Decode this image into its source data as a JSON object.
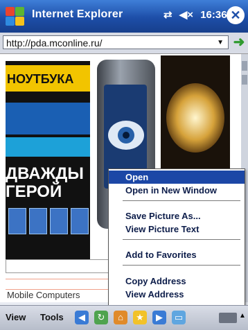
{
  "titlebar": {
    "app_title": "Internet Explorer",
    "connectivity_glyph": "⇄",
    "volume_glyph": "◀×",
    "time": "16:36",
    "close_glyph": "✕"
  },
  "address": {
    "url": "http://pda.mconline.ru/",
    "dropdown_glyph": "▼",
    "go_glyph": "➜"
  },
  "page": {
    "magazine_headline_1": "НОУТБУКА",
    "magazine_headline_2": "ДВАЖДЫ ГЕРОЙ",
    "footer_text": "Mobile Computers"
  },
  "context_menu": {
    "items": [
      {
        "label": "Open"
      },
      {
        "label": "Open in New Window"
      },
      {
        "label": "Save Picture As..."
      },
      {
        "label": "View Picture Text"
      },
      {
        "label": "Add to Favorites"
      },
      {
        "label": "Copy Address"
      },
      {
        "label": "View Address"
      }
    ],
    "selected_index": 0
  },
  "menubar": {
    "view_label": "View",
    "tools_label": "Tools",
    "toolbar_icons": [
      "back-icon",
      "refresh-icon",
      "home-icon",
      "favorites-icon",
      "forward-icon",
      "fullscreen-icon"
    ]
  },
  "colors": {
    "titlebar": "#1d4ea8",
    "menu_selection": "#1c47a6"
  }
}
